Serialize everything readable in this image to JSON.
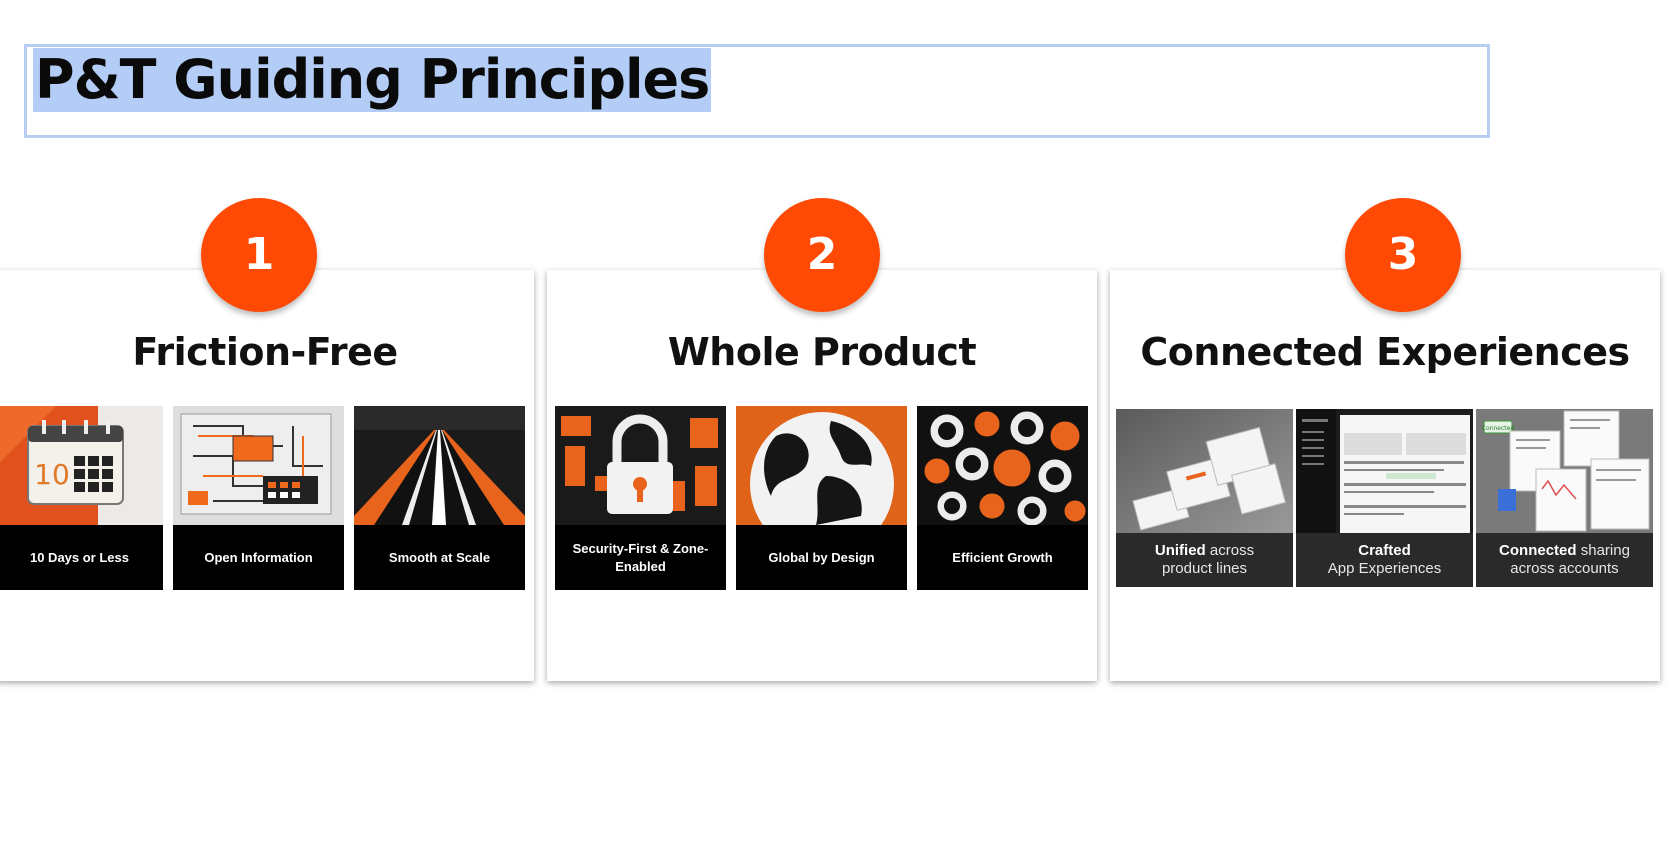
{
  "title": "P&T Guiding Principles",
  "colors": {
    "accent": "#ff4a06",
    "selection": "#b3cdf7",
    "selection_border": "#b7cdf2"
  },
  "principles": [
    {
      "number": "1",
      "heading": "Friction-Free",
      "tiles": [
        {
          "caption": "10 Days or Less",
          "icon": "calendar-icon",
          "calendar_day": "10"
        },
        {
          "caption": "Open Information",
          "icon": "circuit-board-icon"
        },
        {
          "caption": "Smooth at Scale",
          "icon": "highway-icon"
        }
      ]
    },
    {
      "number": "2",
      "heading": "Whole Product",
      "tiles": [
        {
          "caption": "Security-First & Zone-Enabled",
          "icon": "padlock-icon"
        },
        {
          "caption": "Global by Design",
          "icon": "globe-icon"
        },
        {
          "caption": "Efficient Growth",
          "icon": "circles-pattern-icon"
        }
      ]
    },
    {
      "number": "3",
      "heading": "Connected Experiences",
      "tiles": [
        {
          "caption_bold": "Unified",
          "caption_rest_1": " across",
          "caption_rest_2": "product lines",
          "icon": "stacked-screens-icon"
        },
        {
          "caption_bold": "Crafted",
          "caption_rest_1": "",
          "caption_rest_2": "App Experiences",
          "icon": "app-screenshot-icon"
        },
        {
          "caption_bold": "Connected",
          "caption_rest_1": " sharing",
          "caption_rest_2": "across accounts",
          "icon": "shared-documents-icon",
          "chip": "Connected"
        }
      ]
    }
  ]
}
